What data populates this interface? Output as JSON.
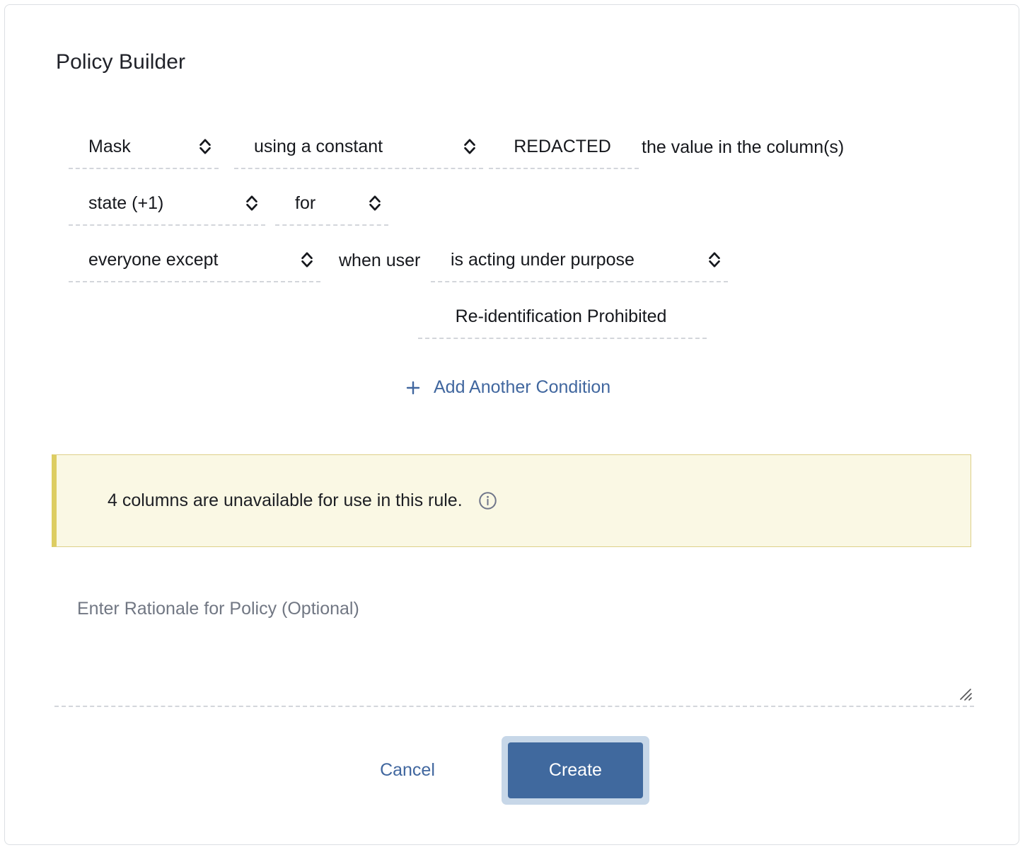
{
  "dialog": {
    "title": "Policy Builder"
  },
  "rule": {
    "action": {
      "value": "Mask",
      "icon": "unfold-more-icon"
    },
    "method": {
      "value": "using a constant",
      "icon": "unfold-more-icon"
    },
    "constant": {
      "value": "REDACTED"
    },
    "value_in_columns_label": "the value in the column(s)",
    "columns": {
      "value": "state (+1)",
      "icon": "unfold-more-icon"
    },
    "for_label": {
      "value": "for",
      "icon": "unfold-more-icon"
    },
    "audience": {
      "value": "everyone except",
      "icon": "unfold-more-icon"
    },
    "when_user_label": "when user",
    "condition": {
      "value": "is acting under purpose",
      "icon": "unfold-more-icon"
    },
    "purpose": {
      "value": "Re-identification Prohibited"
    }
  },
  "add_condition": {
    "label": "Add Another Condition",
    "icon": "plus-icon"
  },
  "warning": {
    "message": "4 columns are unavailable for use in this rule.",
    "icon": "info-circle-icon",
    "background_color": "#faf8e4",
    "accent_color": "#ddcd62"
  },
  "rationale": {
    "value": "",
    "placeholder": "Enter Rationale for Policy (Optional)"
  },
  "footer": {
    "cancel_label": "Cancel",
    "create_label": "Create",
    "primary_color": "#40699e",
    "link_color": "#41679f"
  }
}
